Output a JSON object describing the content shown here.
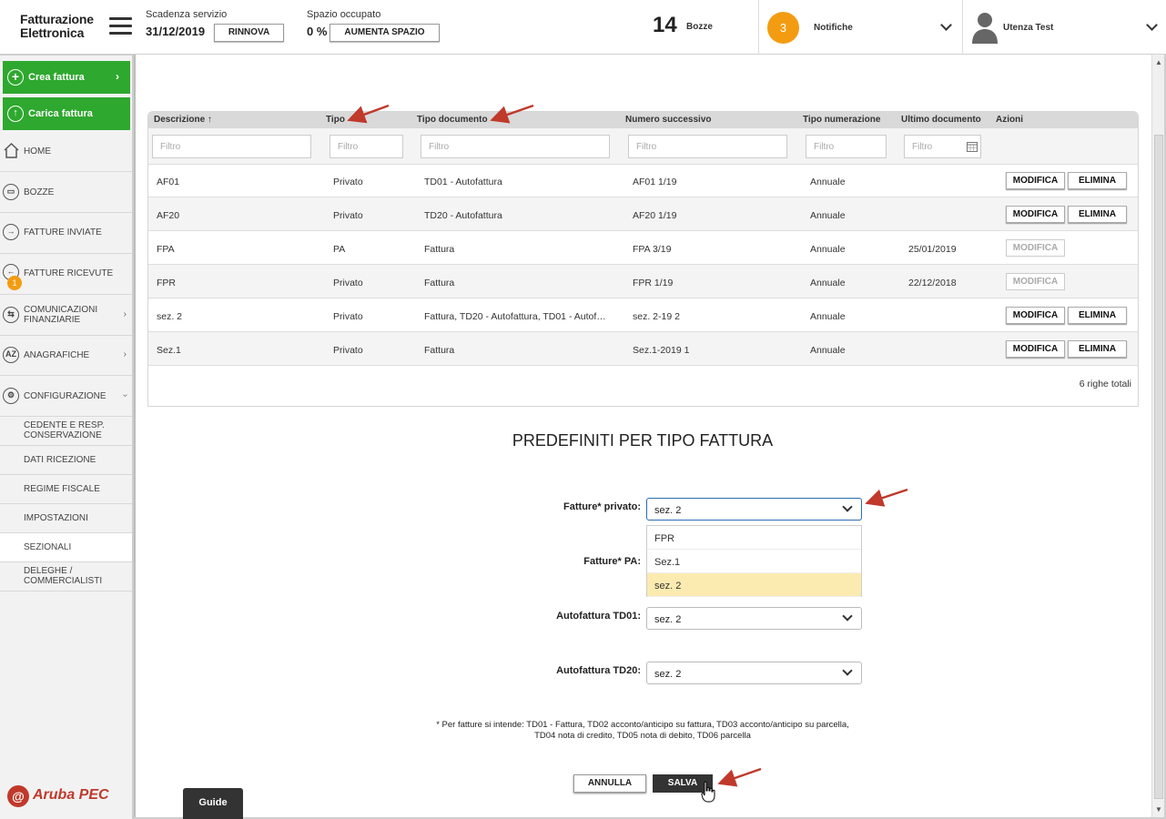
{
  "topbar": {
    "logo_line1": "Fatturazione",
    "logo_line2": "Elettronica",
    "scadenza_label": "Scadenza servizio",
    "scadenza_value": "31/12/2019",
    "rinnova_label": "RINNOVA",
    "spazio_label": "Spazio occupato",
    "spazio_value": "0 %",
    "aumenta_label": "AUMENTA SPAZIO",
    "bozze_count": "14",
    "bozze_label": "Bozze",
    "notifiche_count": "3",
    "notifiche_label": "Notifiche",
    "user_label": "Utenza Test"
  },
  "sidebar": {
    "crea_fattura": "Crea fattura",
    "carica_fattura": "Carica fattura",
    "items": [
      {
        "label": "HOME",
        "icon": "home-icon"
      },
      {
        "label": "BOZZE",
        "icon": "drafts-icon"
      },
      {
        "label": "FATTURE INVIATE",
        "icon": "arrow-right-circle-icon"
      },
      {
        "label": "FATTURE RICEVUTE",
        "icon": "arrow-left-circle-icon"
      },
      {
        "label": "COMUNICAZIONI FINANZIARIE",
        "icon": "exchange-icon"
      },
      {
        "label": "ANAGRAFICHE",
        "icon": "az-icon"
      },
      {
        "label": "CONFIGURAZIONE",
        "icon": "gear-icon"
      }
    ],
    "ricevute_badge": "1",
    "sub_items": [
      "CEDENTE E RESP. CONSERVAZIONE",
      "DATI RICEZIONE",
      "REGIME FISCALE",
      "IMPOSTAZIONI",
      "SEZIONALI",
      "DELEGHE / COMMERCIALISTI"
    ],
    "brand": "Aruba PEC"
  },
  "table": {
    "columns": [
      "Descrizione ↑",
      "Tipo",
      "Tipo documento",
      "Numero successivo",
      "Tipo numerazione",
      "Ultimo documento",
      "Azioni"
    ],
    "filter_placeholder": "Filtro",
    "rows": [
      {
        "descrizione": "AF01",
        "tipo": "Privato",
        "tipo_documento": "TD01 - Autofattura",
        "numero": "AF01 1/19",
        "numerazione": "Annuale",
        "ultimo": "",
        "modifica": "MODIFICA",
        "elimina": "ELIMINA"
      },
      {
        "descrizione": "AF20",
        "tipo": "Privato",
        "tipo_documento": "TD20 - Autofattura",
        "numero": "AF20 1/19",
        "numerazione": "Annuale",
        "ultimo": "",
        "modifica": "MODIFICA",
        "elimina": "ELIMINA"
      },
      {
        "descrizione": "FPA",
        "tipo": "PA",
        "tipo_documento": "Fattura",
        "numero": "FPA 3/19",
        "numerazione": "Annuale",
        "ultimo": "25/01/2019",
        "modifica": "MODIFICA",
        "elimina": ""
      },
      {
        "descrizione": "FPR",
        "tipo": "Privato",
        "tipo_documento": "Fattura",
        "numero": "FPR 1/19",
        "numerazione": "Annuale",
        "ultimo": "22/12/2018",
        "modifica": "MODIFICA",
        "elimina": ""
      },
      {
        "descrizione": "sez. 2",
        "tipo": "Privato",
        "tipo_documento": "Fattura, TD20 - Autofattura, TD01 - Autof…",
        "numero": "sez. 2-19 2",
        "numerazione": "Annuale",
        "ultimo": "",
        "modifica": "MODIFICA",
        "elimina": "ELIMINA"
      },
      {
        "descrizione": "Sez.1",
        "tipo": "Privato",
        "tipo_documento": "Fattura",
        "numero": "Sez.1-2019 1",
        "numerazione": "Annuale",
        "ultimo": "",
        "modifica": "MODIFICA",
        "elimina": "ELIMINA"
      }
    ],
    "total": "6 righe totali"
  },
  "form": {
    "title": "PREDEFINITI PER TIPO FATTURA",
    "privato_label": "Fatture* privato:",
    "privato_value": "sez. 2",
    "pa_label": "Fatture* PA:",
    "dropdown_options": [
      "FPR",
      "Sez.1",
      "sez. 2"
    ],
    "td01_label": "Autofattura TD01:",
    "td01_value": "sez. 2",
    "td20_label": "Autofattura TD20:",
    "td20_value": "sez. 2",
    "note": "* Per fatture si intende: TD01 - Fattura, TD02 acconto/anticipo su fattura, TD03 acconto/anticipo su parcella, TD04 nota di credito, TD05 nota di debito, TD06 parcella",
    "annulla": "ANNULLA",
    "salva": "SALVA"
  },
  "guide_label": "Guide",
  "colors": {
    "green": "#2ea82e",
    "orange": "#f39c12",
    "arrow_red": "#c0392b",
    "dropdown_selected": "#fcebb0"
  }
}
